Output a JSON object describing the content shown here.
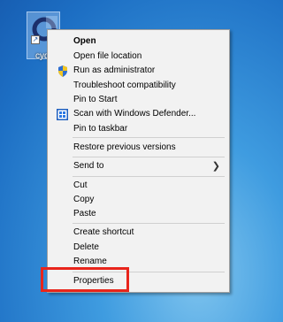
{
  "desktop": {
    "icon_label": "cyd"
  },
  "menu": {
    "items": [
      {
        "label": "Open"
      },
      {
        "label": "Open file location"
      },
      {
        "label": "Run as administrator",
        "icon": "shield-icon"
      },
      {
        "label": "Troubleshoot compatibility"
      },
      {
        "label": "Pin to Start"
      },
      {
        "label": "Scan with Windows Defender...",
        "icon": "defender-icon"
      },
      {
        "label": "Pin to taskbar"
      },
      {
        "label": "Restore previous versions"
      },
      {
        "label": "Send to",
        "submenu_icon": "chevron-right-icon"
      },
      {
        "label": "Cut"
      },
      {
        "label": "Copy"
      },
      {
        "label": "Paste"
      },
      {
        "label": "Create shortcut"
      },
      {
        "label": "Delete"
      },
      {
        "label": "Rename"
      },
      {
        "label": "Properties",
        "highlighted": true
      }
    ]
  },
  "colors": {
    "highlight": "#e8251b",
    "menu_background": "#f2f2f2",
    "desktop": "#1d6fc4"
  }
}
